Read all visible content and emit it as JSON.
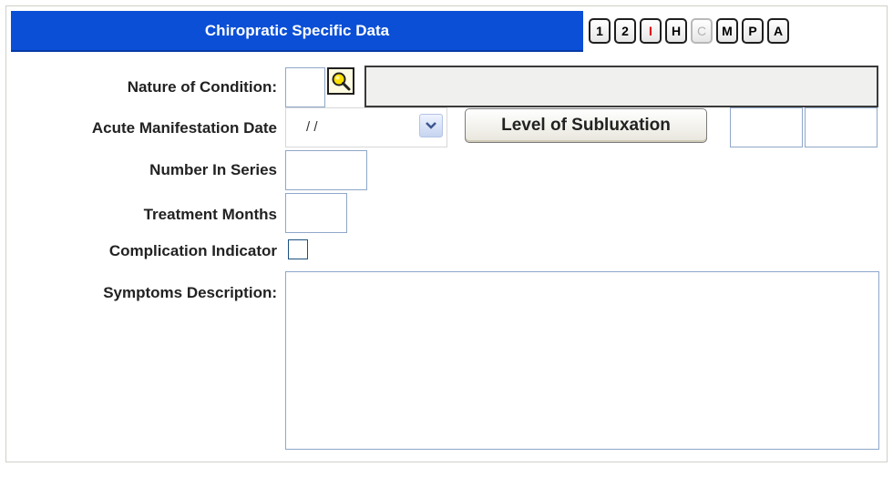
{
  "header": {
    "title": "Chiropratic Specific Data",
    "tabs": [
      "1",
      "2",
      "I",
      "H",
      "C",
      "M",
      "P",
      "A"
    ]
  },
  "form": {
    "nature_label": "Nature of Condition:",
    "nature_code": "",
    "nature_description": "",
    "acute_label": "Acute Manifestation Date",
    "acute_date": "/ /",
    "level_button": "Level of Subluxation",
    "level_field_1": "",
    "level_field_2": "",
    "series_label": "Number In Series",
    "series_value": "",
    "months_label": "Treatment Months",
    "months_value": "",
    "complication_label": "Complication Indicator",
    "complication_checked": false,
    "symptoms_label": "Symptoms Description:",
    "symptoms_value": ""
  },
  "icons": {
    "lookup": "magnifier-icon",
    "dropdown": "chevron-down-icon",
    "scroll_up": "chevron-up-icon",
    "scroll_down": "chevron-down-icon"
  },
  "colors": {
    "titlebar": "#0a4fd6",
    "tab_alert": "#e00000",
    "lookup_yellow": "#ffe000"
  }
}
